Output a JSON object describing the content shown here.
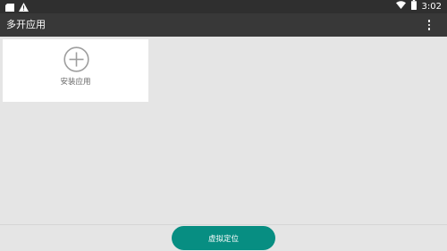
{
  "status_bar": {
    "time": "3:02",
    "icons": [
      "sd-card-icon",
      "warning-icon",
      "wifi-icon",
      "battery-icon"
    ]
  },
  "app_bar": {
    "title": "多开应用",
    "menu_icon": "more-vert-icon"
  },
  "apps_grid": {
    "add_card": {
      "icon": "add-circle-icon",
      "label": "安装应用"
    }
  },
  "bottom_bar": {
    "virtual_location_label": "虚拟定位"
  },
  "colors": {
    "status_bar_bg": "#2f2f2f",
    "app_bar_bg": "#383838",
    "page_bg": "#e5e5e5",
    "card_bg": "#ffffff",
    "accent": "#078e82",
    "icon_gray": "#9e9e9e"
  }
}
